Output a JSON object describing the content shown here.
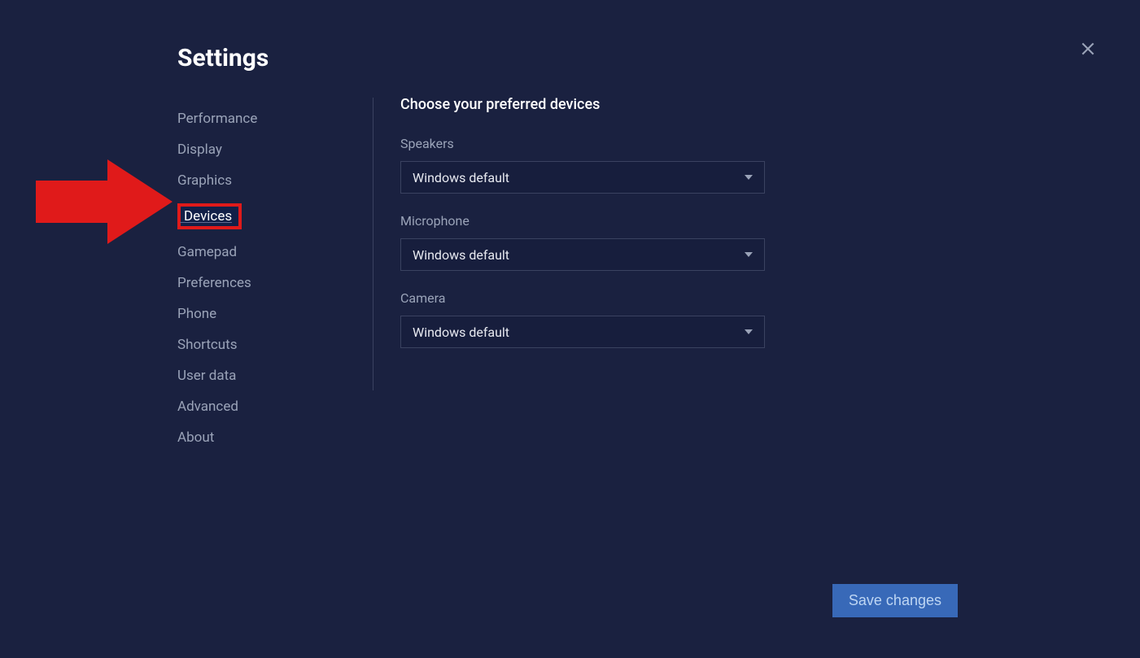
{
  "header": {
    "title": "Settings"
  },
  "sidebar": {
    "items": [
      {
        "label": "Performance",
        "name": "performance"
      },
      {
        "label": "Display",
        "name": "display"
      },
      {
        "label": "Graphics",
        "name": "graphics"
      },
      {
        "label": "Devices",
        "name": "devices",
        "active": true
      },
      {
        "label": "Gamepad",
        "name": "gamepad"
      },
      {
        "label": "Preferences",
        "name": "preferences"
      },
      {
        "label": "Phone",
        "name": "phone"
      },
      {
        "label": "Shortcuts",
        "name": "shortcuts"
      },
      {
        "label": "User data",
        "name": "user-data"
      },
      {
        "label": "Advanced",
        "name": "advanced"
      },
      {
        "label": "About",
        "name": "about"
      }
    ]
  },
  "content": {
    "title": "Choose your preferred devices",
    "fields": [
      {
        "label": "Speakers",
        "value": "Windows default",
        "name": "speakers"
      },
      {
        "label": "Microphone",
        "value": "Windows default",
        "name": "microphone"
      },
      {
        "label": "Camera",
        "value": "Windows default",
        "name": "camera"
      }
    ]
  },
  "footer": {
    "save_label": "Save changes"
  },
  "annotation": {
    "arrow_color": "#e01a1a"
  }
}
